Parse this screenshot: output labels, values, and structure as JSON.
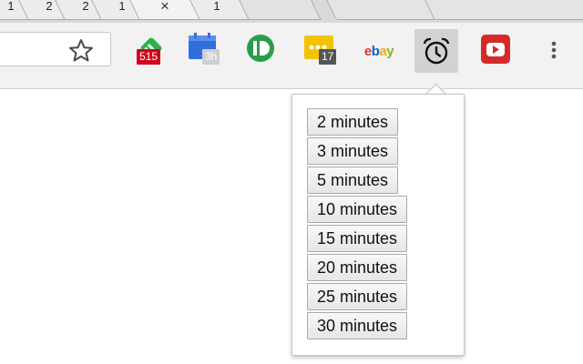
{
  "tabs": [
    {
      "label": "1"
    },
    {
      "label": "2"
    },
    {
      "label": "2"
    },
    {
      "label": "1"
    },
    {
      "label": "×"
    },
    {
      "label": "1"
    }
  ],
  "toolbar": {
    "omnibox_value": "",
    "extensions": [
      {
        "name": "feedly",
        "icon": "feedly-icon",
        "badge": "515",
        "badge_color": "#d0021b"
      },
      {
        "name": "calendar",
        "icon": "calendar-icon",
        "badge": "3h",
        "badge_color": "#cfcfcf"
      },
      {
        "name": "pushbullet",
        "icon": "pushbullet-icon",
        "badge": "",
        "badge_color": ""
      },
      {
        "name": "messages",
        "icon": "message-dots-icon",
        "badge": "17",
        "badge_color": "#555555"
      },
      {
        "name": "ebay",
        "icon": "ebay-icon",
        "badge": "",
        "badge_color": ""
      },
      {
        "name": "alarm",
        "icon": "alarm-clock-icon",
        "badge": "",
        "badge_color": ""
      },
      {
        "name": "youtube",
        "icon": "youtube-icon",
        "badge": "",
        "badge_color": ""
      }
    ],
    "ebay_text": "ebay"
  },
  "popup": {
    "buttons": [
      "2 minutes",
      "3 minutes",
      "5 minutes",
      "10 minutes",
      "15 minutes",
      "20 minutes",
      "25 minutes",
      "30 minutes"
    ]
  }
}
